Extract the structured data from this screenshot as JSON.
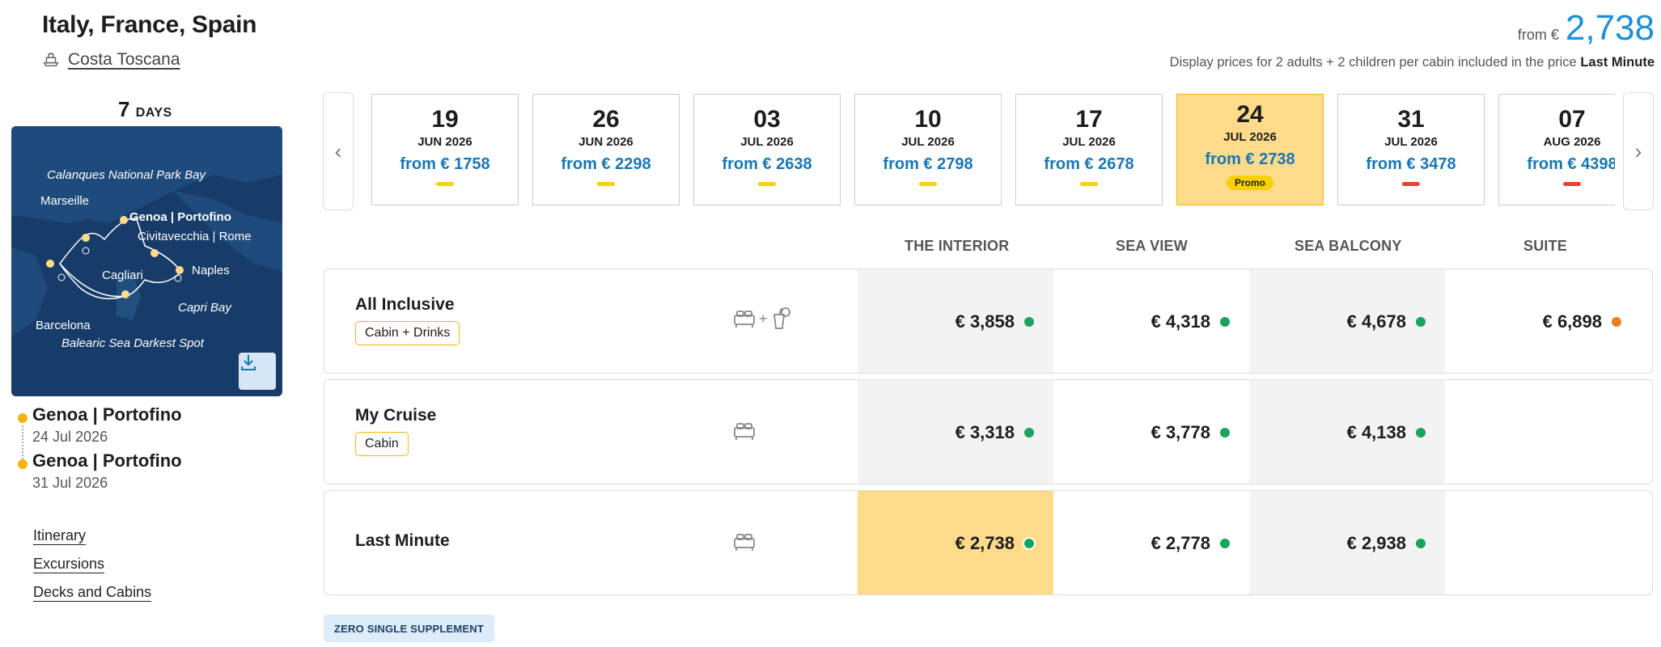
{
  "header": {
    "title": "Italy, France, Spain",
    "ship_name": "Costa Toscana",
    "from_label": "from €",
    "price": "2,738",
    "disclaimer": "Display prices for 2 adults + 2 children per cabin included in the price",
    "disclaimer_bold": "Last Minute"
  },
  "sidebar": {
    "days_number": "7",
    "days_label": "DAYS",
    "map_labels": {
      "calanques": "Calanques National Park Bay",
      "marseille": "Marseille",
      "genoa": "Genoa | Portofino",
      "civitavecchia": "Civitavecchia | Rome",
      "naples": "Naples",
      "cagliari": "Cagliari",
      "capri": "Capri Bay",
      "barcelona": "Barcelona",
      "balearic": "Balearic Sea Darkest Spot"
    },
    "route": [
      {
        "port": "Genoa | Portofino",
        "date": "24 Jul 2026"
      },
      {
        "port": "Genoa | Portofino",
        "date": "31 Jul 2026"
      }
    ],
    "links": [
      "Itinerary",
      "Excursions",
      "Decks and Cabins"
    ]
  },
  "dates": [
    {
      "day": "19",
      "month": "JUN 2026",
      "price": "from € 1758",
      "bar": "#f7d100"
    },
    {
      "day": "26",
      "month": "JUN 2026",
      "price": "from € 2298",
      "bar": "#f7d100"
    },
    {
      "day": "03",
      "month": "JUL 2026",
      "price": "from € 2638",
      "bar": "#f7d100"
    },
    {
      "day": "10",
      "month": "JUL 2026",
      "price": "from € 2798",
      "bar": "#f7d100"
    },
    {
      "day": "17",
      "month": "JUL 2026",
      "price": "from € 2678",
      "bar": "#f7d100"
    },
    {
      "day": "24",
      "month": "JUL 2026",
      "price": "from € 2738",
      "promo": "Promo",
      "selected": true
    },
    {
      "day": "31",
      "month": "JUL 2026",
      "price": "from € 3478",
      "bar": "#e8412e"
    },
    {
      "day": "07",
      "month": "AUG 2026",
      "price": "from € 4398",
      "bar": "#e8412e"
    }
  ],
  "columns": [
    "THE INTERIOR",
    "SEA VIEW",
    "SEA BALCONY",
    "SUITE"
  ],
  "fares": [
    {
      "name": "All Inclusive",
      "tag": "Cabin + Drinks",
      "icon": "bed-plus-drinks-icon",
      "prices": [
        {
          "value": "€ 3,858",
          "status": "green"
        },
        {
          "value": "€ 4,318",
          "status": "green"
        },
        {
          "value": "€ 4,678",
          "status": "green"
        },
        {
          "value": "€ 6,898",
          "status": "orange"
        }
      ]
    },
    {
      "name": "My Cruise",
      "tag": "Cabin",
      "icon": "bed-icon",
      "prices": [
        {
          "value": "€ 3,318",
          "status": "green"
        },
        {
          "value": "€ 3,778",
          "status": "green"
        },
        {
          "value": "€ 4,138",
          "status": "green"
        }
      ]
    },
    {
      "name": "Last Minute",
      "icon": "bed-icon",
      "prices": [
        {
          "value": "€ 2,738",
          "status": "green",
          "selected": true
        },
        {
          "value": "€ 2,778",
          "status": "green"
        },
        {
          "value": "€ 2,938",
          "status": "green"
        }
      ]
    }
  ],
  "badge": "ZERO SINGLE SUPPLEMENT",
  "colors": {
    "accent_blue": "#1b8fe0",
    "highlight": "#fddb8b",
    "status_green": "#19a35b",
    "status_orange": "#ef7f1a",
    "map_sea": "#173c69"
  }
}
